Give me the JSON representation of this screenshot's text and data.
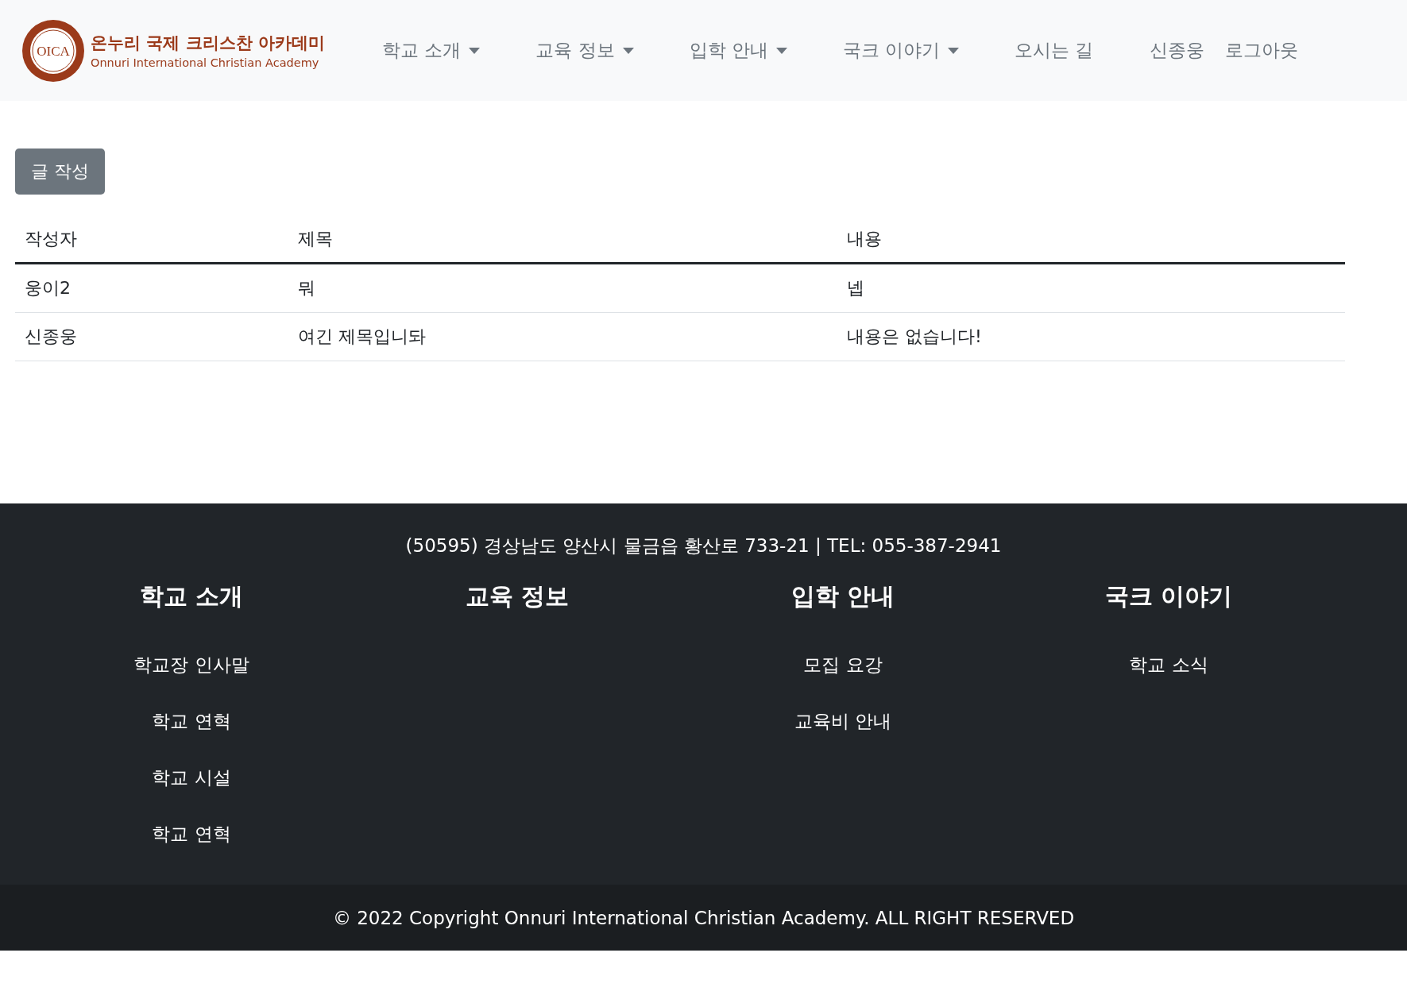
{
  "header": {
    "logo": {
      "seal_text": "OICA",
      "title_ko": "온누리 국제 크리스찬 아카데미",
      "title_en": "Onnuri International Christian Academy"
    },
    "nav": [
      {
        "label": "학교 소개",
        "kind": "dropdown"
      },
      {
        "label": "교육 정보",
        "kind": "dropdown"
      },
      {
        "label": "입학 안내",
        "kind": "dropdown"
      },
      {
        "label": "국크 이야기",
        "kind": "dropdown"
      },
      {
        "label": "오시는 길",
        "kind": "link"
      }
    ],
    "user": "신종웅",
    "logout": "로그아웃"
  },
  "write_button": "글 작성",
  "table": {
    "columns": [
      "작성자",
      "제목",
      "내용"
    ],
    "rows": [
      [
        "웅이2",
        "뭐",
        "넵"
      ],
      [
        "신종웅",
        "여긴 제목입니돠",
        "내용은 없습니다!"
      ]
    ]
  },
  "footer": {
    "address": "(50595) 경상남도 양산시 물금읍 황산로 733-21 | TEL: 055-387-2941",
    "columns": [
      {
        "title": "학교 소개",
        "links": [
          "학교장 인사말",
          "학교 연혁",
          "학교 시설",
          "학교 연혁"
        ]
      },
      {
        "title": "교육 정보"
      },
      {
        "title": "입학 안내",
        "links": [
          "모집 요강",
          "교육비 안내"
        ]
      },
      {
        "title": "국크 이야기",
        "links": [
          "학교 소식"
        ]
      }
    ],
    "copyright": "© 2022 Copyright Onnuri International Christian Academy. ALL RIGHT RESERVED"
  }
}
